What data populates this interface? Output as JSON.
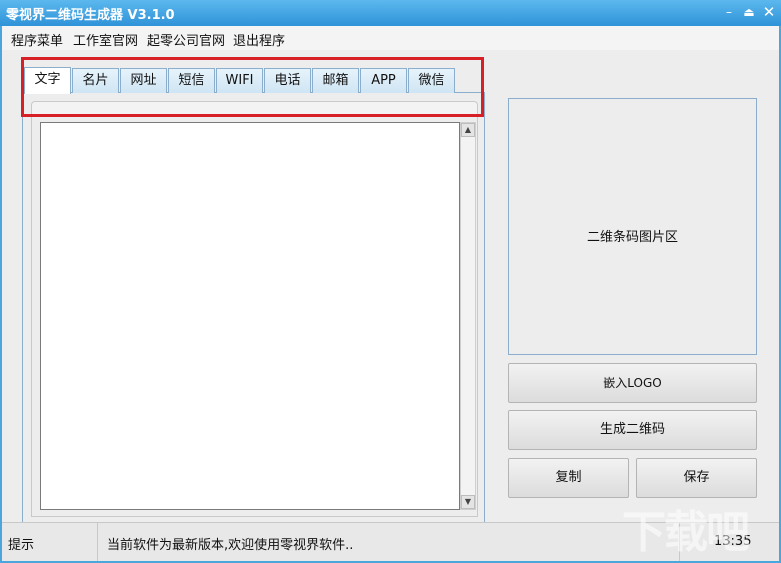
{
  "window": {
    "title": "零视界二维码生成器 V3.1.0",
    "controls": {
      "minimize": "–",
      "maximize": "⏏",
      "close": "✕"
    }
  },
  "menu": [
    "程序菜单",
    "工作室官网",
    "起零公司官网",
    "退出程序"
  ],
  "tabs": [
    "文字",
    "名片",
    "网址",
    "短信",
    "WIFI",
    "电话",
    "邮箱",
    "APP",
    "微信"
  ],
  "active_tab": "文字",
  "text_input": {
    "value": ""
  },
  "scrollbar": {
    "up": "▲",
    "down": "▼"
  },
  "qr_area": {
    "label": "二维条码图片区"
  },
  "buttons": {
    "embed_logo": "嵌入LOGO",
    "generate": "生成二维码",
    "copy": "复制",
    "save": "保存"
  },
  "status": {
    "hint_label": "提示",
    "message": "当前软件为最新版本,欢迎使用零视界软件..",
    "time": "13:35"
  },
  "watermark": "下载吧",
  "colors": {
    "title_bar": "#2f93d8",
    "highlight": "#d71f26",
    "panel_border": "#8aaecb"
  }
}
